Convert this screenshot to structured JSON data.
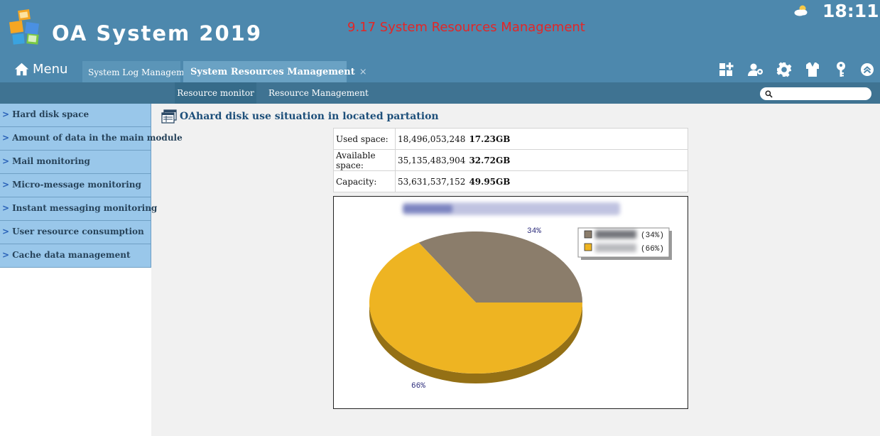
{
  "header": {
    "app_title": "OA System 2019",
    "page_subtitle": "9.17 System Resources Management",
    "clock": "18:11",
    "menu_label": "Menu"
  },
  "tabs": [
    {
      "label": "System Log Management",
      "active": false
    },
    {
      "label": "System Resources Management",
      "active": true,
      "close": "×"
    }
  ],
  "toolbar_icons": [
    "apps-icon",
    "user-settings-icon",
    "gear-icon",
    "shirt-icon",
    "key-icon",
    "collapse-up-icon"
  ],
  "subnav": {
    "items": [
      "Resource monitor",
      "Resource Management"
    ],
    "active": "Resource monitor",
    "search_placeholder": ""
  },
  "sidebar": {
    "items": [
      {
        "label": "Hard disk space"
      },
      {
        "label": "Amount of data in the main module"
      },
      {
        "label": "Mail monitoring"
      },
      {
        "label": "Micro-message monitoring"
      },
      {
        "label": "Instant messaging monitoring"
      },
      {
        "label": "User resource consumption"
      },
      {
        "label": "Cache data management"
      }
    ]
  },
  "content": {
    "title": "OAhard disk use situation in located partation",
    "rows": [
      {
        "label": "Used space:",
        "bytes": "18,496,053,248",
        "gb": "17.23GB"
      },
      {
        "label": "Available space:",
        "bytes": "35,135,483,904",
        "gb": "32.72GB"
      },
      {
        "label": "Capacity:",
        "bytes": "53,631,537,152",
        "gb": "49.95GB"
      }
    ]
  },
  "colors": {
    "header_bg": "#4d88ad",
    "subnav_bg": "#3f7392",
    "sidebar_item_bg": "#99c7ea",
    "subtitle_red": "#e32626",
    "used_slice": "#8b7d6b",
    "available_slice": "#eeb422"
  },
  "chart_data": {
    "type": "pie",
    "title": "",
    "slices": [
      {
        "label": "",
        "value": 34,
        "pct_label": "34%",
        "legend_pct": "(34%)",
        "color": "#8b7d6b"
      },
      {
        "label": "",
        "value": 66,
        "pct_label": "66%",
        "legend_pct": "(66%)",
        "color": "#eeb422"
      }
    ],
    "legend_position": "top-right",
    "style": "3d"
  }
}
